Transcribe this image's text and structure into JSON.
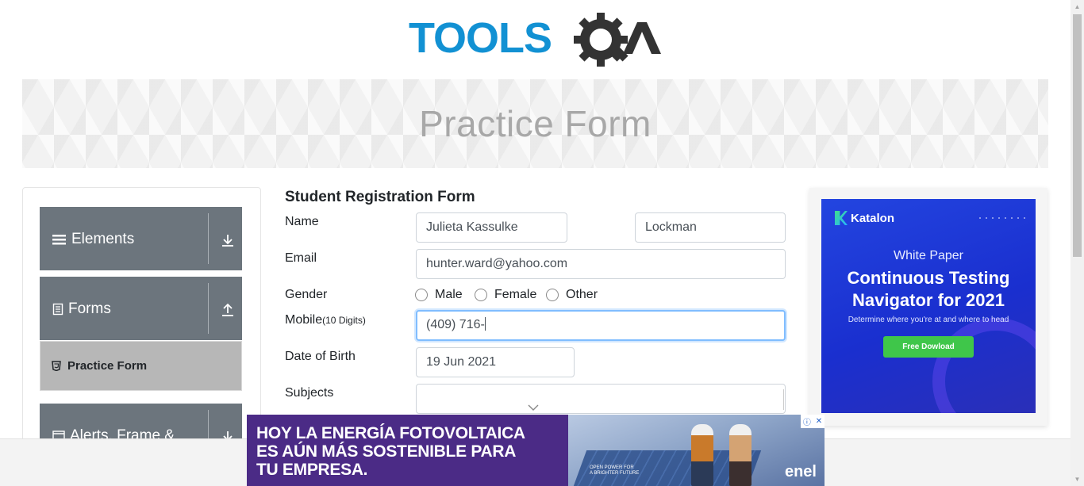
{
  "header": {
    "logo_text": "TOOLSQA",
    "logo_colors": {
      "tools": "#1291d3",
      "qa": "#333333"
    }
  },
  "banner": {
    "title": "Practice Form"
  },
  "sidebar": {
    "groups": [
      {
        "label": "Elements",
        "icon": "hamburger-icon",
        "action_icon": "download-arrow-icon"
      },
      {
        "label": "Forms",
        "icon": "document-icon",
        "action_icon": "upload-arrow-icon"
      },
      {
        "label": "Alerts, Frame &",
        "icon": "window-icon",
        "action_icon": "download-arrow-icon"
      }
    ],
    "active_item": {
      "label": "Practice Form",
      "icon": "html5-icon"
    }
  },
  "form": {
    "title": "Student Registration Form",
    "name_label": "Name",
    "first_name": "Julieta Kassulke",
    "last_name": "Lockman",
    "email_label": "Email",
    "email": "hunter.ward@yahoo.com",
    "gender_label": "Gender",
    "gender_options": [
      "Male",
      "Female",
      "Other"
    ],
    "mobile_label": "Mobile",
    "mobile_hint": "(10 Digits)",
    "mobile": "(409) 716-",
    "dob_label": "Date of Birth",
    "dob": "19 Jun 2021",
    "subjects_label": "Subjects",
    "subjects": ""
  },
  "ad_right": {
    "brand": "Katalon",
    "kicker": "White Paper",
    "headline_1": "Continuous Testing",
    "headline_2": "Navigator for 2021",
    "subtext": "Determine where you're at and where to head",
    "button": "Free Dowload",
    "colors": {
      "bg": "#1f3ad8",
      "button": "#3fc64a"
    }
  },
  "ad_bottom": {
    "line1": "HOY LA ENERGÍA FOTOVOLTAICA",
    "line2": "ES AÚN MÁS SOSTENIBLE PARA",
    "line3": "TU EMPRESA.",
    "small1": "OPEN POWER FOR",
    "small2": "A BRIGHTER FUTURE",
    "brand": "enel",
    "colors": {
      "bg": "#4b2b86"
    }
  }
}
